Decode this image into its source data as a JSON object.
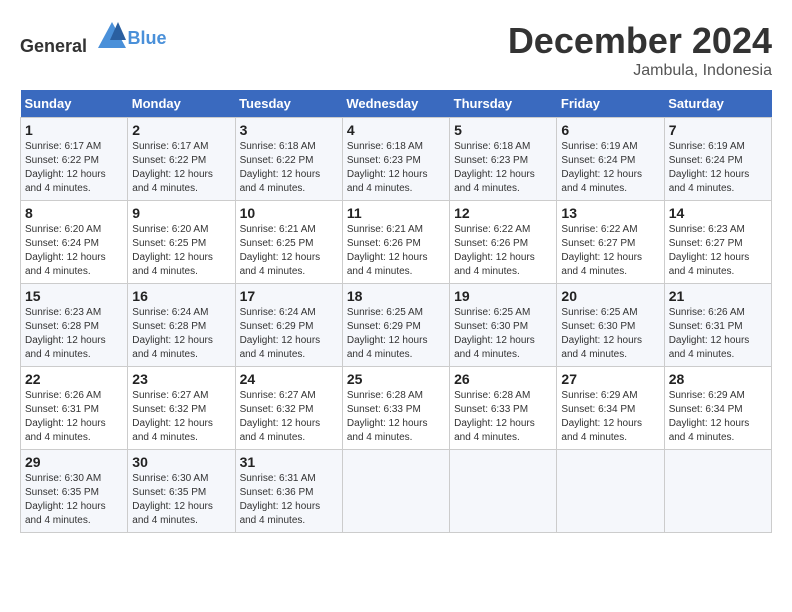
{
  "header": {
    "logo_general": "General",
    "logo_blue": "Blue",
    "month_year": "December 2024",
    "location": "Jambula, Indonesia"
  },
  "days_of_week": [
    "Sunday",
    "Monday",
    "Tuesday",
    "Wednesday",
    "Thursday",
    "Friday",
    "Saturday"
  ],
  "weeks": [
    [
      {
        "day": "1",
        "sunrise": "6:17 AM",
        "sunset": "6:22 PM",
        "daylight": "12 hours and 4 minutes."
      },
      {
        "day": "2",
        "sunrise": "6:17 AM",
        "sunset": "6:22 PM",
        "daylight": "12 hours and 4 minutes."
      },
      {
        "day": "3",
        "sunrise": "6:18 AM",
        "sunset": "6:22 PM",
        "daylight": "12 hours and 4 minutes."
      },
      {
        "day": "4",
        "sunrise": "6:18 AM",
        "sunset": "6:23 PM",
        "daylight": "12 hours and 4 minutes."
      },
      {
        "day": "5",
        "sunrise": "6:18 AM",
        "sunset": "6:23 PM",
        "daylight": "12 hours and 4 minutes."
      },
      {
        "day": "6",
        "sunrise": "6:19 AM",
        "sunset": "6:24 PM",
        "daylight": "12 hours and 4 minutes."
      },
      {
        "day": "7",
        "sunrise": "6:19 AM",
        "sunset": "6:24 PM",
        "daylight": "12 hours and 4 minutes."
      }
    ],
    [
      {
        "day": "8",
        "sunrise": "6:20 AM",
        "sunset": "6:24 PM",
        "daylight": "12 hours and 4 minutes."
      },
      {
        "day": "9",
        "sunrise": "6:20 AM",
        "sunset": "6:25 PM",
        "daylight": "12 hours and 4 minutes."
      },
      {
        "day": "10",
        "sunrise": "6:21 AM",
        "sunset": "6:25 PM",
        "daylight": "12 hours and 4 minutes."
      },
      {
        "day": "11",
        "sunrise": "6:21 AM",
        "sunset": "6:26 PM",
        "daylight": "12 hours and 4 minutes."
      },
      {
        "day": "12",
        "sunrise": "6:22 AM",
        "sunset": "6:26 PM",
        "daylight": "12 hours and 4 minutes."
      },
      {
        "day": "13",
        "sunrise": "6:22 AM",
        "sunset": "6:27 PM",
        "daylight": "12 hours and 4 minutes."
      },
      {
        "day": "14",
        "sunrise": "6:23 AM",
        "sunset": "6:27 PM",
        "daylight": "12 hours and 4 minutes."
      }
    ],
    [
      {
        "day": "15",
        "sunrise": "6:23 AM",
        "sunset": "6:28 PM",
        "daylight": "12 hours and 4 minutes."
      },
      {
        "day": "16",
        "sunrise": "6:24 AM",
        "sunset": "6:28 PM",
        "daylight": "12 hours and 4 minutes."
      },
      {
        "day": "17",
        "sunrise": "6:24 AM",
        "sunset": "6:29 PM",
        "daylight": "12 hours and 4 minutes."
      },
      {
        "day": "18",
        "sunrise": "6:25 AM",
        "sunset": "6:29 PM",
        "daylight": "12 hours and 4 minutes."
      },
      {
        "day": "19",
        "sunrise": "6:25 AM",
        "sunset": "6:30 PM",
        "daylight": "12 hours and 4 minutes."
      },
      {
        "day": "20",
        "sunrise": "6:25 AM",
        "sunset": "6:30 PM",
        "daylight": "12 hours and 4 minutes."
      },
      {
        "day": "21",
        "sunrise": "6:26 AM",
        "sunset": "6:31 PM",
        "daylight": "12 hours and 4 minutes."
      }
    ],
    [
      {
        "day": "22",
        "sunrise": "6:26 AM",
        "sunset": "6:31 PM",
        "daylight": "12 hours and 4 minutes."
      },
      {
        "day": "23",
        "sunrise": "6:27 AM",
        "sunset": "6:32 PM",
        "daylight": "12 hours and 4 minutes."
      },
      {
        "day": "24",
        "sunrise": "6:27 AM",
        "sunset": "6:32 PM",
        "daylight": "12 hours and 4 minutes."
      },
      {
        "day": "25",
        "sunrise": "6:28 AM",
        "sunset": "6:33 PM",
        "daylight": "12 hours and 4 minutes."
      },
      {
        "day": "26",
        "sunrise": "6:28 AM",
        "sunset": "6:33 PM",
        "daylight": "12 hours and 4 minutes."
      },
      {
        "day": "27",
        "sunrise": "6:29 AM",
        "sunset": "6:34 PM",
        "daylight": "12 hours and 4 minutes."
      },
      {
        "day": "28",
        "sunrise": "6:29 AM",
        "sunset": "6:34 PM",
        "daylight": "12 hours and 4 minutes."
      }
    ],
    [
      {
        "day": "29",
        "sunrise": "6:30 AM",
        "sunset": "6:35 PM",
        "daylight": "12 hours and 4 minutes."
      },
      {
        "day": "30",
        "sunrise": "6:30 AM",
        "sunset": "6:35 PM",
        "daylight": "12 hours and 4 minutes."
      },
      {
        "day": "31",
        "sunrise": "6:31 AM",
        "sunset": "6:36 PM",
        "daylight": "12 hours and 4 minutes."
      },
      null,
      null,
      null,
      null
    ]
  ]
}
